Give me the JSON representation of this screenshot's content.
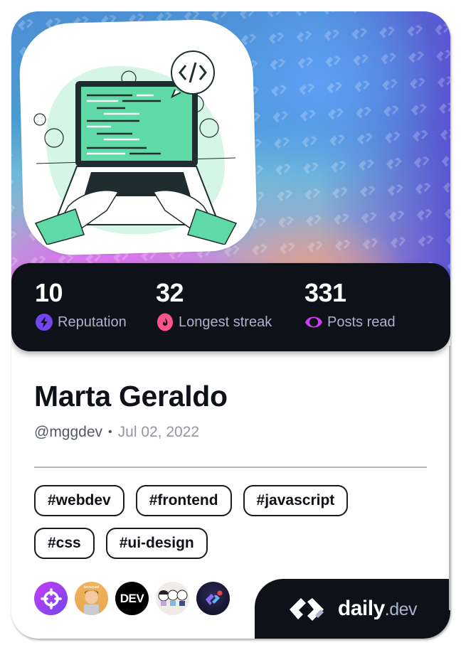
{
  "stats": [
    {
      "value": "10",
      "label": "Reputation",
      "icon": "lightning-icon",
      "color": "#7147ed"
    },
    {
      "value": "32",
      "label": "Longest streak",
      "icon": "flame-icon",
      "color": "#fc538d"
    },
    {
      "value": "331",
      "label": "Posts read",
      "icon": "eye-icon",
      "color": "#ce3df3"
    }
  ],
  "profile": {
    "name": "Marta Geraldo",
    "handle": "@mggdev",
    "separator": "•",
    "joined": "Jul 02, 2022"
  },
  "tags": [
    [
      "#webdev",
      "#frontend",
      "#javascript"
    ],
    [
      "#css",
      "#ui-design"
    ]
  ],
  "sources": [
    {
      "name": "target-source",
      "label": ""
    },
    {
      "name": "devsquad-source",
      "label": "devsquad"
    },
    {
      "name": "dev-to-source",
      "label": "DEV"
    },
    {
      "name": "cartoon-source",
      "label": ""
    },
    {
      "name": "daily-dev-source",
      "label": ""
    }
  ],
  "brand": {
    "name": "daily",
    "tld": ".dev"
  },
  "colors": {
    "dark": "#0e1117",
    "label": "#a8b3cf",
    "accent_green": "#5fd9a6"
  }
}
